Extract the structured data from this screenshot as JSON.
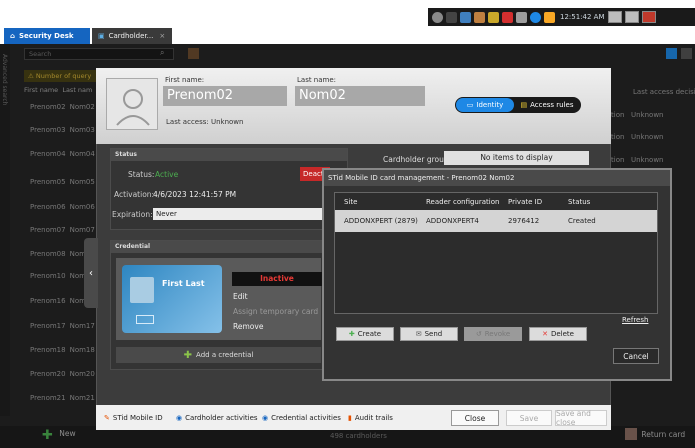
{
  "colors": {
    "accent": "#1565c0",
    "identity_active": "#1e88e5",
    "danger": "#c62828",
    "status_active": "#4caf50",
    "warning": "#d8b43a"
  },
  "system": {
    "time": "12:51:42 AM"
  },
  "tabs": [
    {
      "label": "Security Desk",
      "icon": "home-icon"
    },
    {
      "label": "Cardholder...",
      "icon": "cardholder-icon"
    }
  ],
  "background": {
    "search_placeholder": "Search",
    "side_label": "Advanced search",
    "warning": "Number of query",
    "columns": [
      "First name",
      "Last nam"
    ],
    "right_column": "Last access decisi",
    "rows": [
      {
        "first": "Prenom02",
        "last": "Nom02"
      },
      {
        "first": "Prenom03",
        "last": "Nom03"
      },
      {
        "first": "Prenom04",
        "last": "Nom04"
      },
      {
        "first": "Prenom05",
        "last": "Nom05"
      },
      {
        "first": "Prenom06",
        "last": "Nom06"
      },
      {
        "first": "Prenom07",
        "last": "Nom07"
      },
      {
        "first": "Prenom08",
        "last": "Nom"
      },
      {
        "first": "Prenom10",
        "last": "Nom"
      },
      {
        "first": "Prenom16",
        "last": "Nom"
      },
      {
        "first": "Prenom17",
        "last": "Nom17"
      },
      {
        "first": "Prenom18",
        "last": "Nom18"
      },
      {
        "first": "Prenom20",
        "last": "Nom20"
      },
      {
        "first": "Prenom21",
        "last": "Nom21"
      }
    ],
    "right_values": [
      "Unknown",
      "Unknown",
      "Unknown"
    ],
    "right_prefix": "tion",
    "footer_new": "New",
    "footer_count": "498 cardholders",
    "footer_return": "Return card"
  },
  "cardholder": {
    "first_name_label": "First name:",
    "first_name": "Prenom02",
    "last_name_label": "Last name:",
    "last_name": "Nom02",
    "last_access": "Last access: Unknown",
    "segment_identity": "Identity",
    "segment_access": "Access rules",
    "status_title": "Status",
    "status_label": "Status:",
    "status_value": "Active",
    "deactivate": "Deact",
    "activation_label": "Activation:",
    "activation_value": "4/6/2023 12:41:57 PM",
    "expiration_label": "Expiration:",
    "expiration_value": "Never",
    "credential_title": "Credential",
    "card_name": "First Last",
    "card_inactive": "Inactive",
    "card_menu": [
      "Edit",
      "Assign temporary card",
      "Remove"
    ],
    "add_credential": "Add a credential",
    "group_label": "Cardholder group:",
    "group_value": "No items to display"
  },
  "bottom_bar": {
    "items": [
      "STid Mobile ID",
      "Cardholder activities",
      "Credential activities",
      "Audit trails"
    ],
    "close": "Close",
    "save": "Save",
    "save_close": "Save and close"
  },
  "stid": {
    "title": "STid Mobile ID card management - Prenom02 Nom02",
    "columns": [
      "Site",
      "Reader configuration",
      "Private ID",
      "Status"
    ],
    "row": {
      "site": "ADDONXPERT (2879)",
      "reader": "ADDONXPERT4",
      "private_id": "2976412",
      "status": "Created"
    },
    "refresh": "Refresh",
    "buttons": {
      "create": "Create",
      "send": "Send",
      "revoke": "Revoke",
      "delete": "Delete"
    },
    "cancel": "Cancel"
  }
}
